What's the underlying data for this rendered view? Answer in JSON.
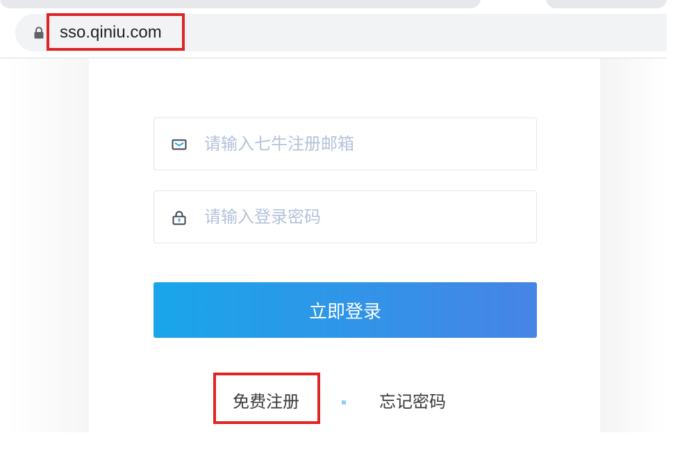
{
  "browser": {
    "url": "sso.qiniu.com",
    "icons": {
      "lock": "lock-icon"
    }
  },
  "login_form": {
    "email": {
      "placeholder": "请输入七牛注册邮箱",
      "value": "",
      "icon": "mail-icon"
    },
    "password": {
      "placeholder": "请输入登录密码",
      "value": "",
      "icon": "lock-icon"
    },
    "submit_label": "立即登录"
  },
  "links": {
    "register": "免费注册",
    "forgot_password": "忘记密码"
  },
  "colors": {
    "button_gradient_start": "#18a6e9",
    "button_gradient_end": "#4784e6",
    "placeholder": "#b4c2dc",
    "highlight_box": "#e02424",
    "separator": "#8ed1f2"
  }
}
